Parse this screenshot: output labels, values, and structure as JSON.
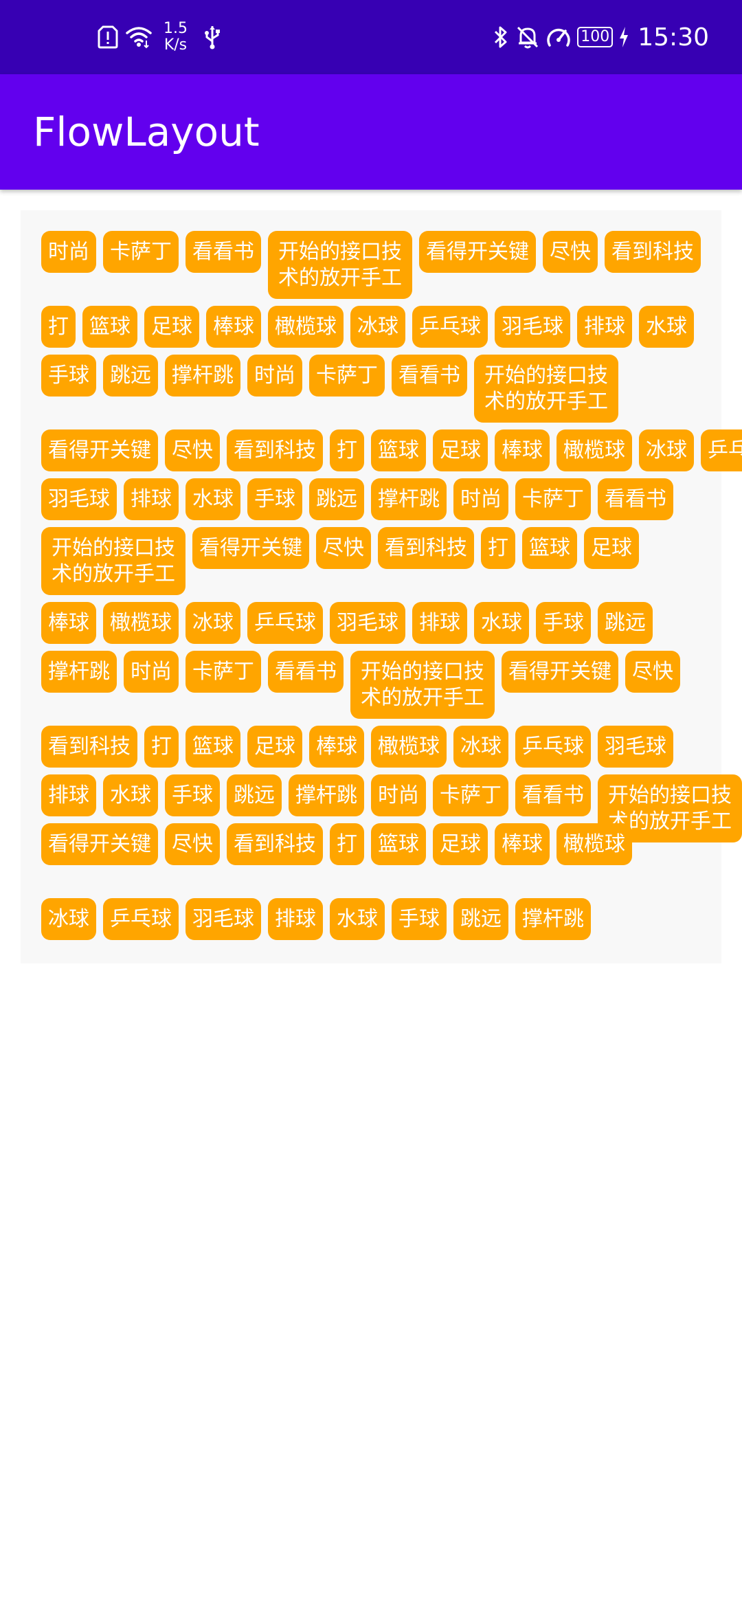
{
  "status_bar": {
    "speed_value": "1.5",
    "speed_unit": "K/s",
    "battery": "100",
    "time": "15:30",
    "icons_left": [
      "sim-alert-icon",
      "wifi-icon",
      "usb-icon"
    ],
    "icons_right": [
      "bluetooth-icon",
      "bell-off-icon",
      "speedometer-icon",
      "battery-icon",
      "charging-icon"
    ]
  },
  "app_bar": {
    "title": "FlowLayout"
  },
  "colors": {
    "status_bar": "#3700b3",
    "app_bar": "#6200ee",
    "tag_background": "#ffa500",
    "tag_text": "#ffffff",
    "flow_background": "#f8f8f8"
  },
  "tags": [
    "时尚",
    "卡萨丁",
    "看看书",
    "开始的接口技术的放开手工",
    "看得开关键",
    "尽快",
    "看到科技",
    "打",
    "篮球",
    "足球",
    "棒球",
    "橄榄球",
    "冰球",
    "乒乓球",
    "羽毛球",
    "排球",
    "水球",
    "手球",
    "跳远",
    "撑杆跳",
    "时尚",
    "卡萨丁",
    "看看书",
    "开始的接口技术的放开手工",
    "看得开关键",
    "尽快",
    "看到科技",
    "打",
    "篮球",
    "足球",
    "棒球",
    "橄榄球",
    "冰球",
    "乒乓球",
    "羽毛球",
    "排球",
    "水球",
    "手球",
    "跳远",
    "撑杆跳",
    "时尚",
    "卡萨丁",
    "看看书",
    "开始的接口技术的放开手工",
    "看得开关键",
    "尽快",
    "看到科技",
    "打",
    "篮球",
    "足球",
    "棒球",
    "橄榄球",
    "冰球",
    "乒乓球",
    "羽毛球",
    "排球",
    "水球",
    "手球",
    "跳远",
    "撑杆跳",
    "时尚",
    "卡萨丁",
    "看看书",
    "开始的接口技术的放开手工",
    "看得开关键",
    "尽快",
    "看到科技",
    "打",
    "篮球",
    "足球",
    "棒球",
    "橄榄球",
    "冰球",
    "乒乓球",
    "羽毛球",
    "排球",
    "水球",
    "手球",
    "跳远",
    "撑杆跳",
    "时尚",
    "卡萨丁",
    "看看书",
    "开始的接口技术的放开手工",
    "看得开关键",
    "尽快",
    "看到科技",
    "打",
    "篮球",
    "足球",
    "棒球",
    "橄榄球",
    "冰球",
    "乒乓球",
    "羽毛球",
    "排球",
    "水球",
    "手球",
    "跳远",
    "撑杆跳"
  ]
}
